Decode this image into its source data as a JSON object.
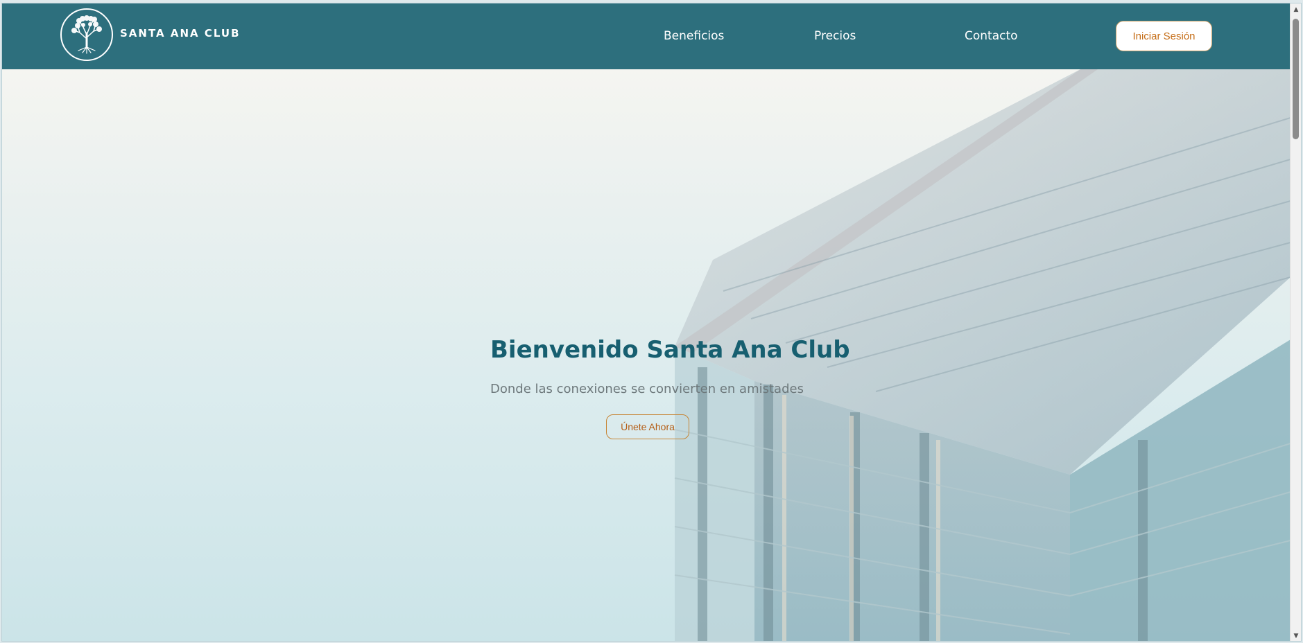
{
  "brand": {
    "name": "SANTA ANA CLUB",
    "logo_icon": "tree-icon"
  },
  "nav": {
    "items": [
      {
        "label": "Beneficios"
      },
      {
        "label": "Precios"
      },
      {
        "label": "Contacto"
      }
    ],
    "login_label": "Iniciar Sesión"
  },
  "hero": {
    "title": "Bienvenido Santa Ana Club",
    "subtitle": "Donde las conexiones se convierten en amistades",
    "cta_label": "Únete Ahora"
  },
  "colors": {
    "navbar": "#2d6f7d",
    "title": "#175f70",
    "accent": "#c56d17"
  }
}
